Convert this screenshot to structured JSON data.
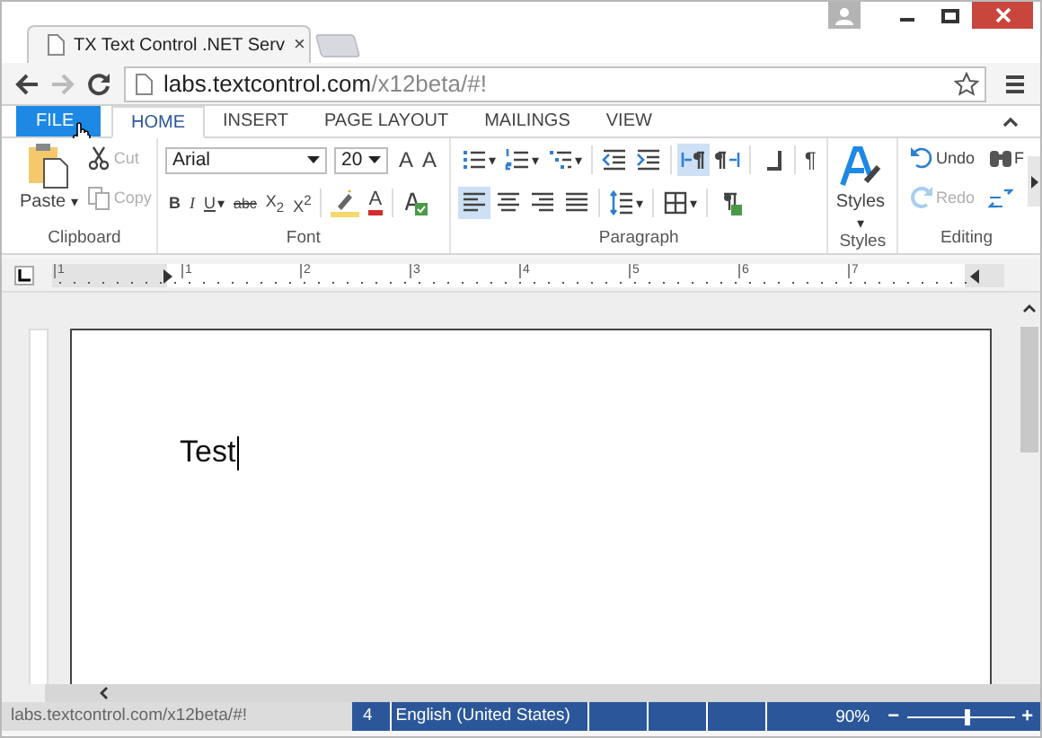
{
  "browser": {
    "tab": {
      "title": "TX Text Control .NET Serv",
      "close": "×"
    },
    "address": {
      "host": "labs.textcontrol.com",
      "path": "/x12beta/#!"
    },
    "status_url": "labs.textcontrol.com/x12beta/#!"
  },
  "ribbon_tabs": [
    {
      "label": "FILE",
      "kind": "file",
      "selected": false
    },
    {
      "label": "HOME",
      "kind": "tab",
      "selected": true
    },
    {
      "label": "INSERT",
      "kind": "tab",
      "selected": false
    },
    {
      "label": "PAGE LAYOUT",
      "kind": "tab",
      "selected": false
    },
    {
      "label": "MAILINGS",
      "kind": "tab",
      "selected": false
    },
    {
      "label": "VIEW",
      "kind": "tab",
      "selected": false
    }
  ],
  "ribbon_groups": [
    {
      "title": "Clipboard",
      "kind": "clipboard",
      "paste": {
        "label": "Paste",
        "caret": "▾"
      },
      "items": [
        {
          "kind": "cut",
          "label": "Cut",
          "disabled": true
        },
        {
          "kind": "copy",
          "label": "Copy",
          "disabled": true
        }
      ]
    },
    {
      "title": "Font",
      "kind": "font",
      "font_name": "Arial",
      "font_size": "20",
      "row1": [
        {
          "kind": "grow",
          "label": "A"
        },
        {
          "kind": "shrink",
          "label": "A"
        }
      ],
      "row2": [
        {
          "kind": "bold",
          "label": "B"
        },
        {
          "kind": "italic",
          "label": "I"
        },
        {
          "kind": "underline",
          "label": "U",
          "caret": "▾"
        },
        {
          "kind": "strike",
          "label": "abc"
        },
        {
          "kind": "sub",
          "label": "X$_{2}$"
        },
        {
          "kind": "super",
          "label": "X$^{2}$"
        },
        {
          "kind": "highlight"
        },
        {
          "kind": "fontcolor",
          "label": "A"
        },
        {
          "kind": "clear"
        }
      ]
    },
    {
      "title": "Paragraph",
      "kind": "paragraph",
      "row1": [
        {
          "kind": "bullets",
          "caret": "▾",
          "selected": false
        },
        {
          "kind": "numbering",
          "caret": "▾",
          "selected": false
        },
        {
          "kind": "multilevel",
          "caret": "▾",
          "selected": false
        },
        {
          "kind": "outdent",
          "selected": false
        },
        {
          "kind": "indent",
          "selected": false
        },
        {
          "kind": "ltr",
          "selected": true
        },
        {
          "kind": "rtl",
          "selected": false
        },
        {
          "kind": "tabstop",
          "selected": false
        },
        {
          "kind": "marks",
          "label": "¶",
          "selected": false
        }
      ],
      "row2": [
        {
          "kind": "left",
          "selected": true
        },
        {
          "kind": "center",
          "selected": false
        },
        {
          "kind": "right",
          "selected": false
        },
        {
          "kind": "justify",
          "selected": false
        },
        {
          "kind": "spacing",
          "caret": "▾",
          "selected": false
        },
        {
          "kind": "borders",
          "caret": "▾",
          "selected": false
        },
        {
          "kind": "parastyle",
          "selected": false
        }
      ]
    },
    {
      "title": "Styles",
      "kind": "styles",
      "label": "Styles",
      "caret": "▾"
    },
    {
      "title": "Editing",
      "kind": "editing",
      "items": [
        {
          "kind": "undo",
          "label": "Undo",
          "disabled": false
        },
        {
          "kind": "redo",
          "label": "Redo",
          "disabled": true
        }
      ],
      "side": [
        {
          "kind": "find",
          "label": "F"
        },
        {
          "kind": "replace"
        }
      ]
    }
  ],
  "ruler": {
    "labels": [
      "1",
      "1",
      "2",
      "3",
      "4",
      "5",
      "6",
      "7"
    ]
  },
  "document": {
    "text": "Test"
  },
  "status_bar": {
    "page": "4",
    "language": "English (United States)",
    "zoom": "90%",
    "minus": "−",
    "plus": "+",
    "zoom_slider": {
      "level": 0.55
    }
  }
}
